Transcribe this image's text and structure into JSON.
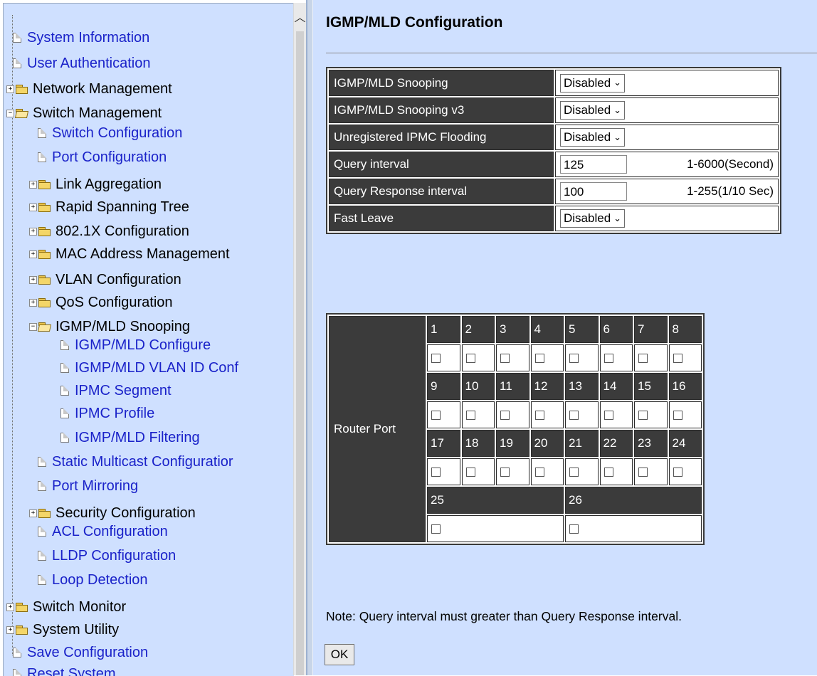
{
  "nav": {
    "items": [
      {
        "label": "System Information",
        "kind": "doc",
        "level": 0
      },
      {
        "label": "User Authentication",
        "kind": "doc",
        "level": 0
      },
      {
        "label": "Network Management",
        "kind": "folder",
        "level": 0,
        "expanded": false
      },
      {
        "label": "Switch Management",
        "kind": "folder",
        "level": 0,
        "expanded": true
      },
      {
        "label": "Switch Configuration",
        "kind": "doc",
        "level": 1
      },
      {
        "label": "Port Configuration",
        "kind": "doc",
        "level": 1
      },
      {
        "label": "Link Aggregation",
        "kind": "folder",
        "level": 1,
        "expanded": false
      },
      {
        "label": "Rapid Spanning Tree",
        "kind": "folder",
        "level": 1,
        "expanded": false
      },
      {
        "label": "802.1X Configuration",
        "kind": "folder",
        "level": 1,
        "expanded": false
      },
      {
        "label": "MAC Address Management",
        "kind": "folder",
        "level": 1,
        "expanded": false
      },
      {
        "label": "VLAN Configuration",
        "kind": "folder",
        "level": 1,
        "expanded": false
      },
      {
        "label": "QoS Configuration",
        "kind": "folder",
        "level": 1,
        "expanded": false
      },
      {
        "label": "IGMP/MLD Snooping",
        "kind": "folder",
        "level": 1,
        "expanded": true
      },
      {
        "label": "IGMP/MLD Configure",
        "kind": "doc",
        "level": 2
      },
      {
        "label": "IGMP/MLD VLAN ID Conf",
        "kind": "doc",
        "level": 2
      },
      {
        "label": "IPMC Segment",
        "kind": "doc",
        "level": 2
      },
      {
        "label": "IPMC Profile",
        "kind": "doc",
        "level": 2
      },
      {
        "label": "IGMP/MLD Filtering",
        "kind": "doc",
        "level": 2
      },
      {
        "label": "Static Multicast Configuratior",
        "kind": "doc",
        "level": 1
      },
      {
        "label": "Port Mirroring",
        "kind": "doc",
        "level": 1
      },
      {
        "label": "Security Configuration",
        "kind": "folder",
        "level": 1,
        "expanded": false
      },
      {
        "label": "ACL Configuration",
        "kind": "doc",
        "level": 1
      },
      {
        "label": "LLDP Configuration",
        "kind": "doc",
        "level": 1
      },
      {
        "label": "Loop Detection",
        "kind": "doc",
        "level": 1
      },
      {
        "label": "Switch Monitor",
        "kind": "folder",
        "level": 0,
        "expanded": false
      },
      {
        "label": "System Utility",
        "kind": "folder",
        "level": 0,
        "expanded": false
      },
      {
        "label": "Save Configuration",
        "kind": "doc",
        "level": 0
      },
      {
        "label": "Reset System",
        "kind": "doc",
        "level": 0
      }
    ]
  },
  "page": {
    "title": "IGMP/MLD Configuration",
    "settings": [
      {
        "label": "IGMP/MLD Snooping",
        "type": "select",
        "value": "Disabled"
      },
      {
        "label": "IGMP/MLD Snooping v3",
        "type": "select",
        "value": "Disabled"
      },
      {
        "label": "Unregistered IPMC Flooding",
        "type": "select",
        "value": "Disabled"
      },
      {
        "label": "Query interval",
        "type": "text",
        "value": "125",
        "range": "1-6000(Second)"
      },
      {
        "label": "Query Response interval",
        "type": "text",
        "value": "100",
        "range": "1-255(1/10 Sec)"
      },
      {
        "label": "Fast Leave",
        "type": "select",
        "value": "Disabled"
      }
    ],
    "router_port": {
      "label": "Router Port",
      "rows": [
        [
          "1",
          "2",
          "3",
          "4",
          "5",
          "6",
          "7",
          "8"
        ],
        [
          "9",
          "10",
          "11",
          "12",
          "13",
          "14",
          "15",
          "16"
        ],
        [
          "17",
          "18",
          "19",
          "20",
          "21",
          "22",
          "23",
          "24"
        ]
      ],
      "last_row": [
        "25",
        "26"
      ]
    },
    "note": "Note: Query interval must greater than Query Response interval.",
    "ok_label": "OK"
  }
}
